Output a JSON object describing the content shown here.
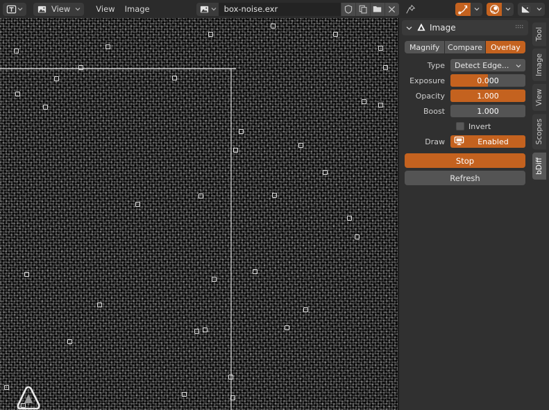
{
  "topbar": {
    "editor_type_icon": "image-editor-icon",
    "mode_dropdown": {
      "icon": "image-icon",
      "label": "View"
    },
    "menus": [
      {
        "label": "View"
      },
      {
        "label": "Image"
      }
    ],
    "datablock": {
      "icon": "image-icon",
      "name": "box-noise.exr",
      "buttons": [
        {
          "name": "fake-user-button",
          "icon": "shield-icon"
        },
        {
          "name": "new-image-button",
          "icon": "copy-icon"
        },
        {
          "name": "open-image-button",
          "icon": "folder-icon"
        },
        {
          "name": "unlink-image-button",
          "icon": "close-icon"
        }
      ],
      "pin": {
        "name": "pin-button",
        "icon": "pin-icon"
      }
    },
    "right_buttons": [
      {
        "name": "view-transform-button",
        "icon": "curve-icon",
        "active": true
      },
      {
        "name": "gizmo-button",
        "icon": "sphere-icon",
        "active": true
      },
      {
        "name": "overlays-button",
        "icon": "overlay-icon",
        "active": false
      }
    ]
  },
  "canvas": {
    "image_name": "box-noise.exr",
    "logo": "triangle-logo"
  },
  "sidebar": {
    "panel": {
      "title": "Image",
      "icon": "triangle-icon",
      "collapse_icon": "chevron-down-icon",
      "grip_icon": "grip-dots-icon"
    },
    "segments": [
      {
        "label": "Magnify",
        "active": false
      },
      {
        "label": "Compare",
        "active": false
      },
      {
        "label": "Overlay",
        "active": true
      }
    ],
    "fields": [
      {
        "name": "type",
        "label": "Type",
        "kind": "dropdown",
        "value": "Detect Edge..."
      },
      {
        "name": "exposure",
        "label": "Exposure",
        "kind": "slider",
        "value": "0.000",
        "fill_pct": 50
      },
      {
        "name": "opacity",
        "label": "Opacity",
        "kind": "slider",
        "value": "1.000",
        "fill_pct": 100
      },
      {
        "name": "boost",
        "label": "Boost",
        "kind": "slider",
        "value": "1.000",
        "fill_pct": 0
      }
    ],
    "checkbox": {
      "label": "Invert",
      "checked": false
    },
    "draw": {
      "label": "Draw",
      "value": "Enabled",
      "icon": "monitor-icon",
      "enabled": true
    },
    "buttons": [
      {
        "name": "stop-button",
        "label": "Stop",
        "style": "stop"
      },
      {
        "name": "refresh-button",
        "label": "Refresh",
        "style": "refresh"
      }
    ]
  },
  "tabs": [
    {
      "label": "Tool",
      "active": false
    },
    {
      "label": "Image",
      "active": false
    },
    {
      "label": "View",
      "active": false
    },
    {
      "label": "Scopes",
      "active": false
    },
    {
      "label": "bDiff",
      "active": true
    }
  ],
  "colors": {
    "accent": "#c4621f",
    "panel_bg": "#303030",
    "header_bg": "#2b2b2b",
    "widget_bg": "#545454"
  }
}
